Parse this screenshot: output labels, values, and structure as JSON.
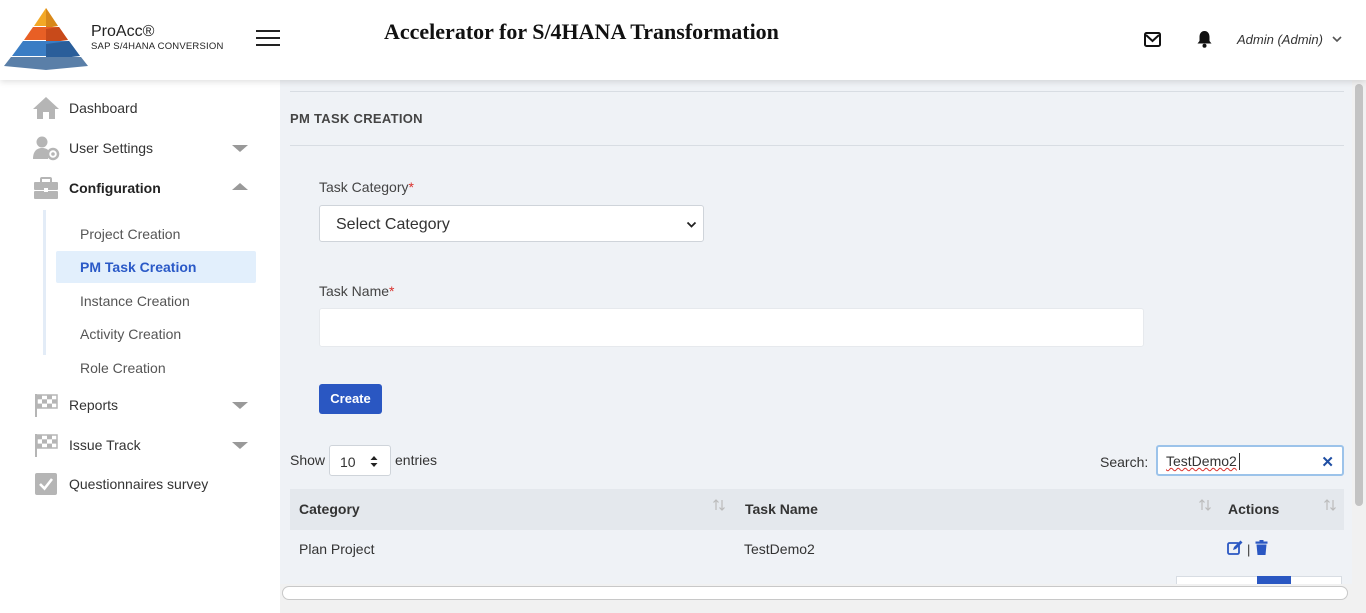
{
  "header": {
    "brand_name": "ProAcc®",
    "brand_subtitle": "SAP S/4HANA CONVERSION",
    "app_title": "Accelerator for S/4HANA Transformation",
    "user_label": "Admin (Admin)"
  },
  "sidebar": {
    "items": [
      {
        "label": "Dashboard",
        "icon": "home-icon"
      },
      {
        "label": "User Settings",
        "icon": "user-settings-icon",
        "caret": "down"
      },
      {
        "label": "Configuration",
        "icon": "briefcase-icon",
        "caret": "up",
        "expanded": true
      },
      {
        "label": "Reports",
        "icon": "checkered-flag-icon",
        "caret": "down"
      },
      {
        "label": "Issue Track",
        "icon": "checkered-flag-icon",
        "caret": "down"
      },
      {
        "label": "Questionnaires survey",
        "icon": "checkbox-icon"
      }
    ],
    "submenu": [
      {
        "label": "Project Creation"
      },
      {
        "label": "PM Task Creation",
        "active": true
      },
      {
        "label": "Instance Creation"
      },
      {
        "label": "Activity Creation"
      },
      {
        "label": "Role Creation"
      }
    ]
  },
  "main": {
    "section_title": "PM TASK CREATION",
    "task_category_label": "Task Category",
    "required_mark": "*",
    "task_category_value": "Select Category",
    "task_name_label": "Task Name",
    "task_name_value": "",
    "create_button": "Create",
    "show_label": "Show",
    "entries_value": "10",
    "entries_label": "entries",
    "search_label": "Search:",
    "search_value": "TestDemo2",
    "table": {
      "columns": [
        "Category",
        "Task Name",
        "Actions"
      ],
      "rows": [
        {
          "category": "Plan Project",
          "task_name": "TestDemo2",
          "actions_separator": "|"
        }
      ]
    }
  },
  "colors": {
    "primary": "#2a57c2",
    "active_bg": "#e2effc",
    "main_bg": "#eff2f6",
    "required": "#d9302c"
  }
}
